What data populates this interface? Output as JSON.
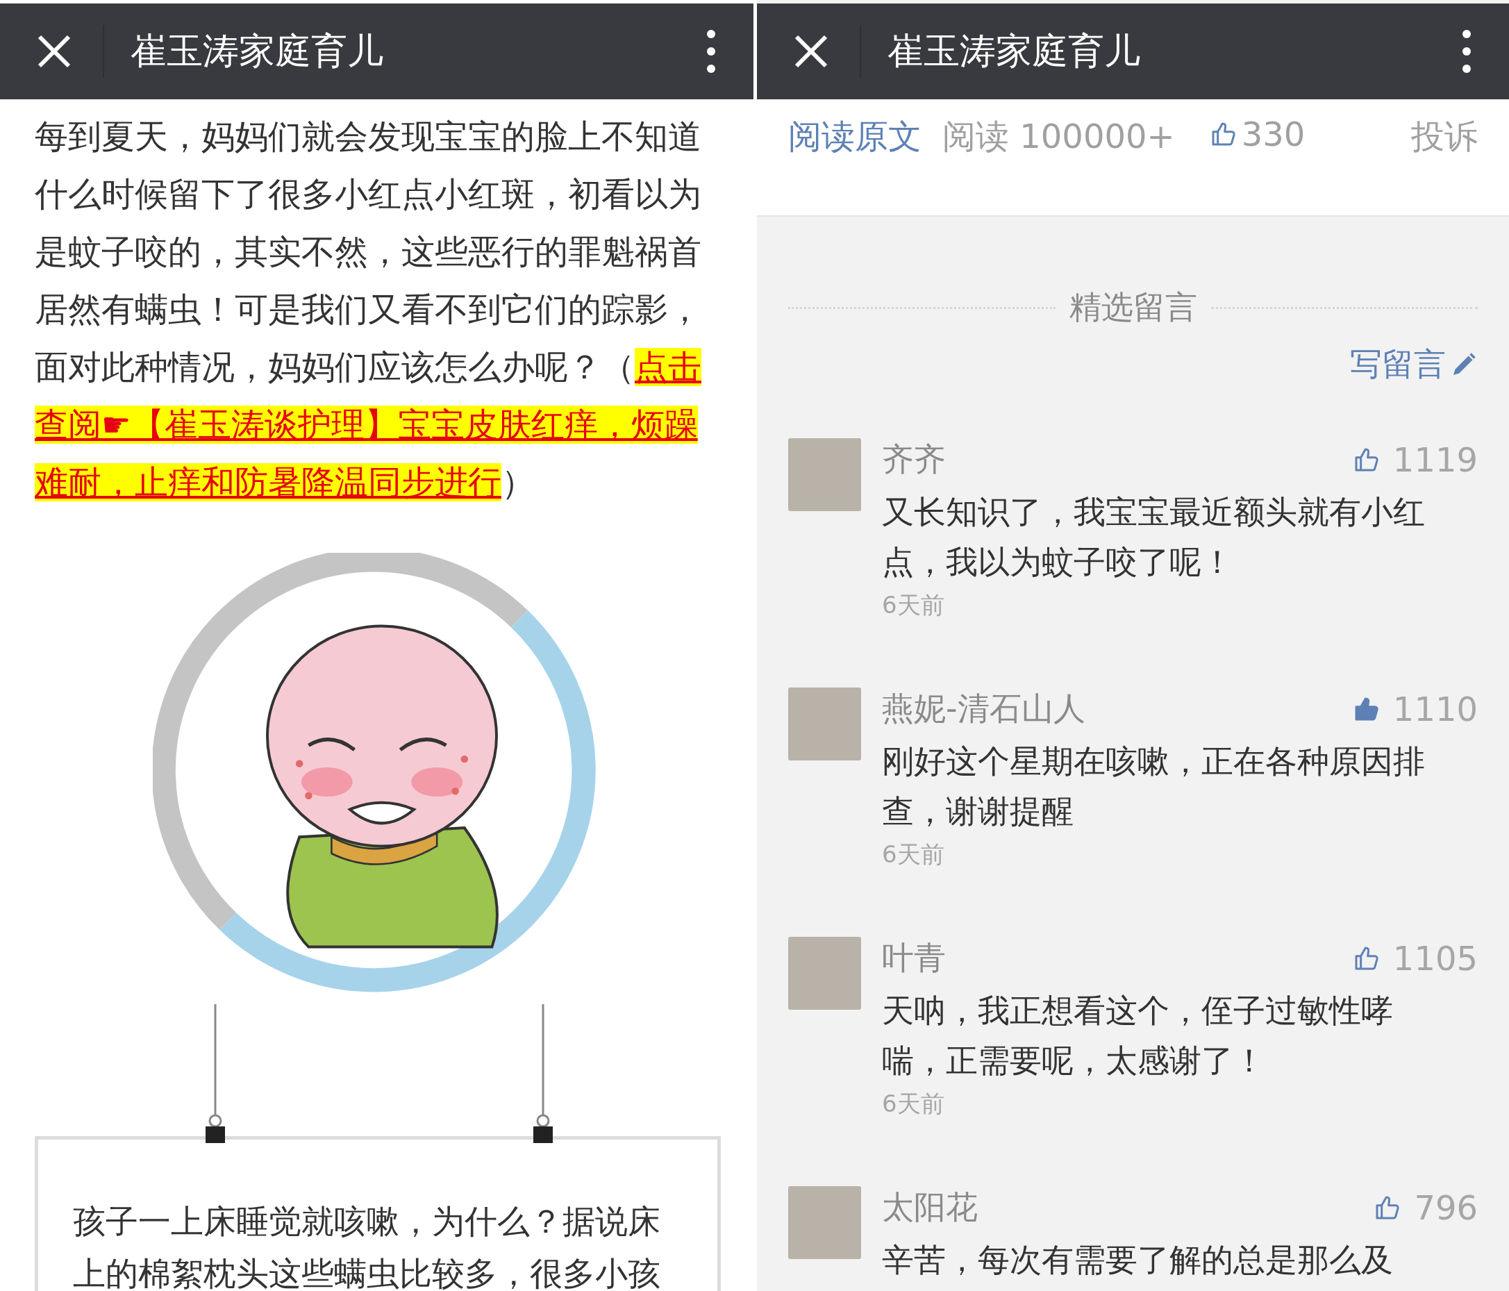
{
  "left_panel": {
    "header": {
      "title": "崔玉涛家庭育儿"
    },
    "article": {
      "paragraph_text": "每到夏天，妈妈们就会发现宝宝的脸上不知道什么时候留下了很多小红点小红斑，初看以为是蚊子咬的，其实不然，这些恶行的罪魁祸首居然有螨虫！可是我们又看不到它们的踪影，面对此种情况，妈妈们应该怎么办呢？（",
      "link_lines": [
        "点击",
        "查阅☛【崔玉涛谈护理】宝宝皮肤红痒，烦躁",
        "难耐，止痒和防暑降温同步进行"
      ],
      "paragraph_end": "）",
      "card_text": "孩子一上床睡觉就咳嗽，为什么？据说床上的棉絮枕头这些螨虫比较多，很多小孩"
    }
  },
  "right_panel": {
    "header": {
      "title": "崔玉涛家庭育儿"
    },
    "article_footer": {
      "read_original": "阅读原文",
      "reads": "阅读 100000+",
      "likes": "330",
      "report": "投诉"
    },
    "comments_section": {
      "title": "精选留言",
      "write_comment": "写留言",
      "comments": [
        {
          "name": "齐齐",
          "likes": "1119",
          "liked": false,
          "text": "又长知识了，我宝宝最近额头就有小红点，我以为蚊子咬了呢！",
          "time": "6天前"
        },
        {
          "name": "燕妮-清石山人",
          "likes": "1110",
          "liked": true,
          "text": "刚好这个星期在咳嗽，正在各种原因排查，谢谢提醒",
          "time": "6天前"
        },
        {
          "name": "叶青",
          "likes": "1105",
          "liked": false,
          "text": "天呐，我正想看这个，侄子过敏性哮喘，正需要呢，太感谢了！",
          "time": "6天前"
        },
        {
          "name": "太阳花",
          "likes": "796",
          "liked": false,
          "text": "辛苦，每次有需要了解的总是那么及"
        }
      ]
    }
  }
}
